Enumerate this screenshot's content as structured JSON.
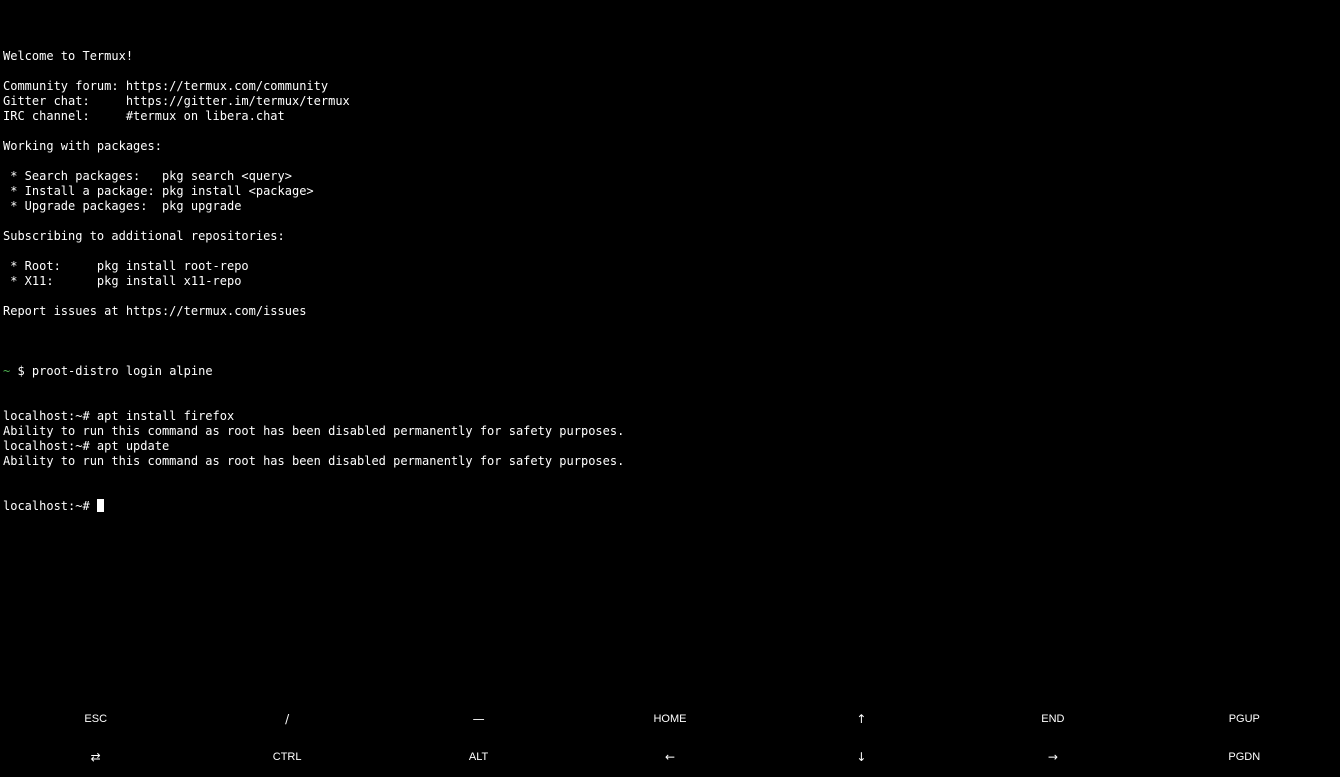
{
  "terminal": {
    "lines": [
      {
        "text": "Welcome to Termux!"
      },
      {
        "text": ""
      },
      {
        "text": "Community forum: https://termux.com/community"
      },
      {
        "text": "Gitter chat:     https://gitter.im/termux/termux"
      },
      {
        "text": "IRC channel:     #termux on libera.chat"
      },
      {
        "text": ""
      },
      {
        "text": "Working with packages:"
      },
      {
        "text": ""
      },
      {
        "text": " * Search packages:   pkg search <query>"
      },
      {
        "text": " * Install a package: pkg install <package>"
      },
      {
        "text": " * Upgrade packages:  pkg upgrade"
      },
      {
        "text": ""
      },
      {
        "text": "Subscribing to additional repositories:"
      },
      {
        "text": ""
      },
      {
        "text": " * Root:     pkg install root-repo"
      },
      {
        "text": " * X11:      pkg install x11-repo"
      },
      {
        "text": ""
      },
      {
        "text": "Report issues at https://termux.com/issues"
      },
      {
        "text": ""
      }
    ],
    "shell_prompt": {
      "tilde": "~",
      "symbol": " $ ",
      "command": "proot-distro login alpine"
    },
    "session": [
      {
        "text": "localhost:~# apt install firefox"
      },
      {
        "text": "Ability to run this command as root has been disabled permanently for safety purposes."
      },
      {
        "text": "localhost:~# apt update"
      },
      {
        "text": "Ability to run this command as root has been disabled permanently for safety purposes."
      }
    ],
    "current_prompt": "localhost:~# ",
    "colors": {
      "background": "#000000",
      "foreground": "#ffffff",
      "tilde": "#4caf50"
    }
  },
  "extra_keys": {
    "row1": [
      {
        "label": "ESC",
        "name": "esc"
      },
      {
        "label": "/",
        "name": "slash"
      },
      {
        "label": "—",
        "name": "dash"
      },
      {
        "label": "HOME",
        "name": "home"
      },
      {
        "label": "↑",
        "name": "arrow-up"
      },
      {
        "label": "END",
        "name": "end"
      },
      {
        "label": "PGUP",
        "name": "pgup"
      }
    ],
    "row2": [
      {
        "label": "⇄",
        "name": "tab",
        "icon": "tab-icon"
      },
      {
        "label": "CTRL",
        "name": "ctrl"
      },
      {
        "label": "ALT",
        "name": "alt"
      },
      {
        "label": "←",
        "name": "arrow-left"
      },
      {
        "label": "↓",
        "name": "arrow-down"
      },
      {
        "label": "→",
        "name": "arrow-right"
      },
      {
        "label": "PGDN",
        "name": "pgdn"
      }
    ]
  }
}
